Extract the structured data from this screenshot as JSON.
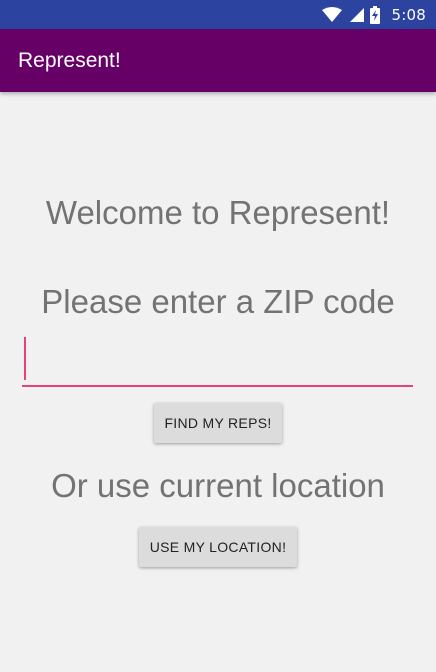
{
  "status_bar": {
    "time": "5:08",
    "icons": [
      "wifi-icon",
      "cell-signal-icon",
      "battery-charging-icon"
    ],
    "color": "#2c44a0"
  },
  "app_bar": {
    "title": "Represent!",
    "color": "#660066"
  },
  "main": {
    "welcome": "Welcome to Represent!",
    "zip_prompt": "Please enter a ZIP code",
    "zip_input": {
      "value": "",
      "accent": "#e8407a"
    },
    "find_button": "FIND MY REPS!",
    "or_text": "Or use current location",
    "location_button": "USE MY LOCATION!"
  }
}
